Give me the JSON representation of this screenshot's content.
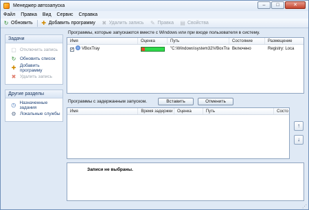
{
  "window": {
    "title": "Менеджер автозапуска"
  },
  "menu": [
    "Файл",
    "Правка",
    "Вид",
    "Сервис",
    "Справка"
  ],
  "toolbar": {
    "refresh": "Обновить",
    "add_program": "Добавить программу",
    "delete_entry": "Удалить запись",
    "edit": "Правка",
    "properties": "Свойства"
  },
  "taskpane": {
    "tasks_title": "Задачи",
    "tasks": [
      {
        "label": "Отключить запись",
        "icon": "disable-icon",
        "enabled": false
      },
      {
        "label": "Обновить список",
        "icon": "refresh-icon",
        "enabled": true
      },
      {
        "label": "Добавить программу",
        "icon": "add-program-icon",
        "enabled": true
      },
      {
        "label": "Удалить запись",
        "icon": "delete-icon",
        "enabled": false
      }
    ],
    "other_title": "Другие разделы",
    "other": [
      {
        "label": "Назначенные задания",
        "icon": "scheduled-tasks-icon"
      },
      {
        "label": "Локальные службы",
        "icon": "services-icon"
      }
    ]
  },
  "startup": {
    "caption": "Программы, которые запускаются вместе с Windows или при входе пользователя в систему.",
    "columns": [
      "Имя",
      "Оценка",
      "Путь",
      "Состояние",
      "Размещение"
    ],
    "rows": [
      {
        "name": "VBoxTray",
        "rating": 0.15,
        "path": "\"C:\\Windows\\system32\\VBoxTray.exe\"",
        "state": "Включено",
        "location": "Registry: Loca"
      }
    ]
  },
  "delayed": {
    "caption": "Программы с задержанным запуском.",
    "insert_button": "Вставить",
    "cancel_button": "Отменить",
    "columns": [
      "Имя",
      "Время задержки",
      "Оценка",
      "Путь",
      "Состо"
    ]
  },
  "details": {
    "empty_text": "Записи не выбраны."
  },
  "colors": {
    "accent": "#1b3f75",
    "rating_good": "#2fd94a",
    "rating_bad": "#e34a2a"
  }
}
